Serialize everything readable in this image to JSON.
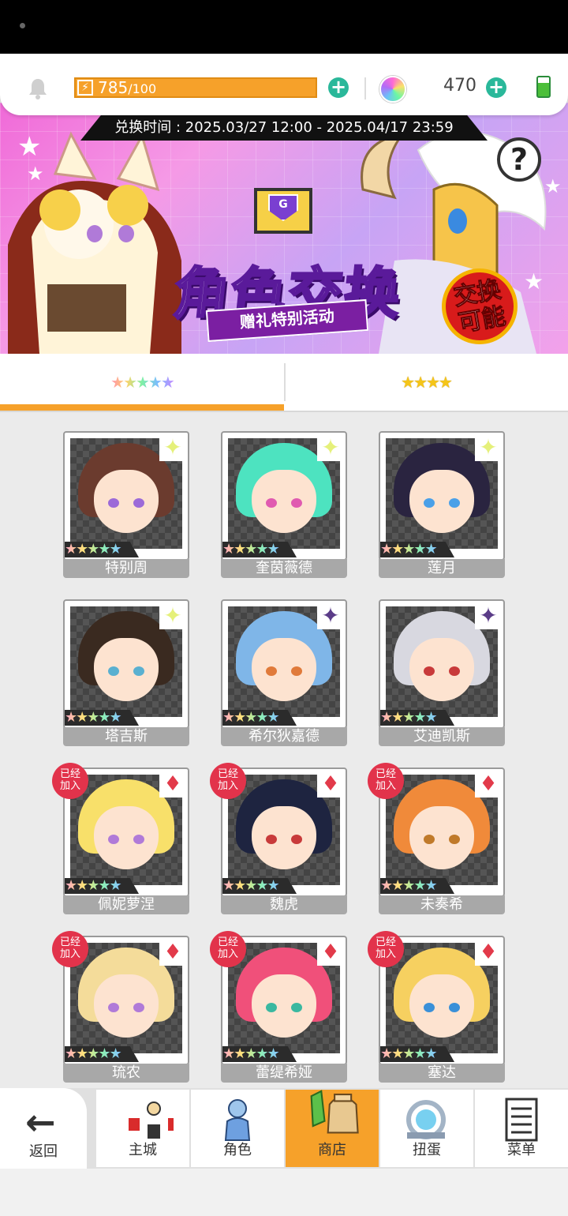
{
  "topbar": {
    "energy_current": "785",
    "energy_max": "/100",
    "gem_count": "470"
  },
  "banner": {
    "exchange_time": "兑换时间 : 2025.03/27 12:00 - 2025.04/17 23:59",
    "title": "角色交换",
    "subtitle": "赠礼特别活动",
    "badge_line1": "交换",
    "badge_line2": "可能",
    "help_symbol": "?",
    "mail_letter": "G"
  },
  "tabs": [
    {
      "label": "★★★★★",
      "style": "rainbow",
      "selected": true
    },
    {
      "label": "★★★★",
      "style": "gold",
      "selected": false
    }
  ],
  "characters": [
    {
      "name": "特别周",
      "stars": "★★★★★",
      "element": "✦",
      "element_type": "light",
      "joined": false,
      "hair": "#6b3b2e",
      "eye": "#9c6ad8"
    },
    {
      "name": "奎茵薇德",
      "stars": "★★★★★",
      "element": "✦",
      "element_type": "light",
      "joined": false,
      "hair": "#4de3c0",
      "eye": "#e05ab0"
    },
    {
      "name": "莲月",
      "stars": "★★★★★",
      "element": "✦",
      "element_type": "light",
      "joined": false,
      "hair": "#2a2440",
      "eye": "#4aa0e8"
    },
    {
      "name": "塔吉斯",
      "stars": "★★★★★",
      "element": "✦",
      "element_type": "light",
      "joined": false,
      "hair": "#3a2a20",
      "eye": "#5ab0d0"
    },
    {
      "name": "希尔狄嘉德",
      "stars": "★★★★★",
      "element": "✦",
      "element_type": "dark",
      "joined": false,
      "hair": "#7fb6e8",
      "eye": "#e07a3a"
    },
    {
      "name": "艾迪凯斯",
      "stars": "★★★★★",
      "element": "✦",
      "element_type": "dark",
      "joined": false,
      "hair": "#d8d8e0",
      "eye": "#c83a3a"
    },
    {
      "name": "佩妮萝涅",
      "stars": "★★★★★",
      "element": "♦",
      "element_type": "red",
      "joined": true,
      "joined_text": "已经\n加入",
      "hair": "#f8e06a",
      "eye": "#b07ad8"
    },
    {
      "name": "魏虎",
      "stars": "★★★★★",
      "element": "♦",
      "element_type": "red",
      "joined": true,
      "joined_text": "已经\n加入",
      "hair": "#1e2440",
      "eye": "#c83a3a"
    },
    {
      "name": "未奏希",
      "stars": "★★★★★",
      "element": "♦",
      "element_type": "red",
      "joined": true,
      "joined_text": "已经\n加入",
      "hair": "#f08a3a",
      "eye": "#c07a2a"
    },
    {
      "name": "琉农",
      "stars": "★★★★★",
      "element": "♦",
      "element_type": "red",
      "joined": true,
      "joined_text": "已经\n加入",
      "hair": "#f4dc9a",
      "eye": "#b07ad8"
    },
    {
      "name": "蕾缇希娅",
      "stars": "★★★★★",
      "element": "♦",
      "element_type": "red",
      "joined": true,
      "joined_text": "已经\n加入",
      "hair": "#f0507a",
      "eye": "#3ab8a0"
    },
    {
      "name": "塞达",
      "stars": "★★★★★",
      "element": "♦",
      "element_type": "red",
      "joined": true,
      "joined_text": "已经\n加入",
      "hair": "#f6d060",
      "eye": "#3a90d8"
    }
  ],
  "nav": {
    "back": "返回",
    "items": [
      {
        "label": "主城",
        "icon": "castle-icon",
        "active": false
      },
      {
        "label": "角色",
        "icon": "character-icon",
        "active": false
      },
      {
        "label": "商店",
        "icon": "shop-icon",
        "active": true
      },
      {
        "label": "扭蛋",
        "icon": "gacha-icon",
        "active": false
      },
      {
        "label": "菜单",
        "icon": "menu-icon",
        "active": false
      }
    ]
  },
  "colors": {
    "accent": "#f6a12a",
    "energy_plus": "#2ab89a",
    "joined_badge": "#e2334b"
  }
}
